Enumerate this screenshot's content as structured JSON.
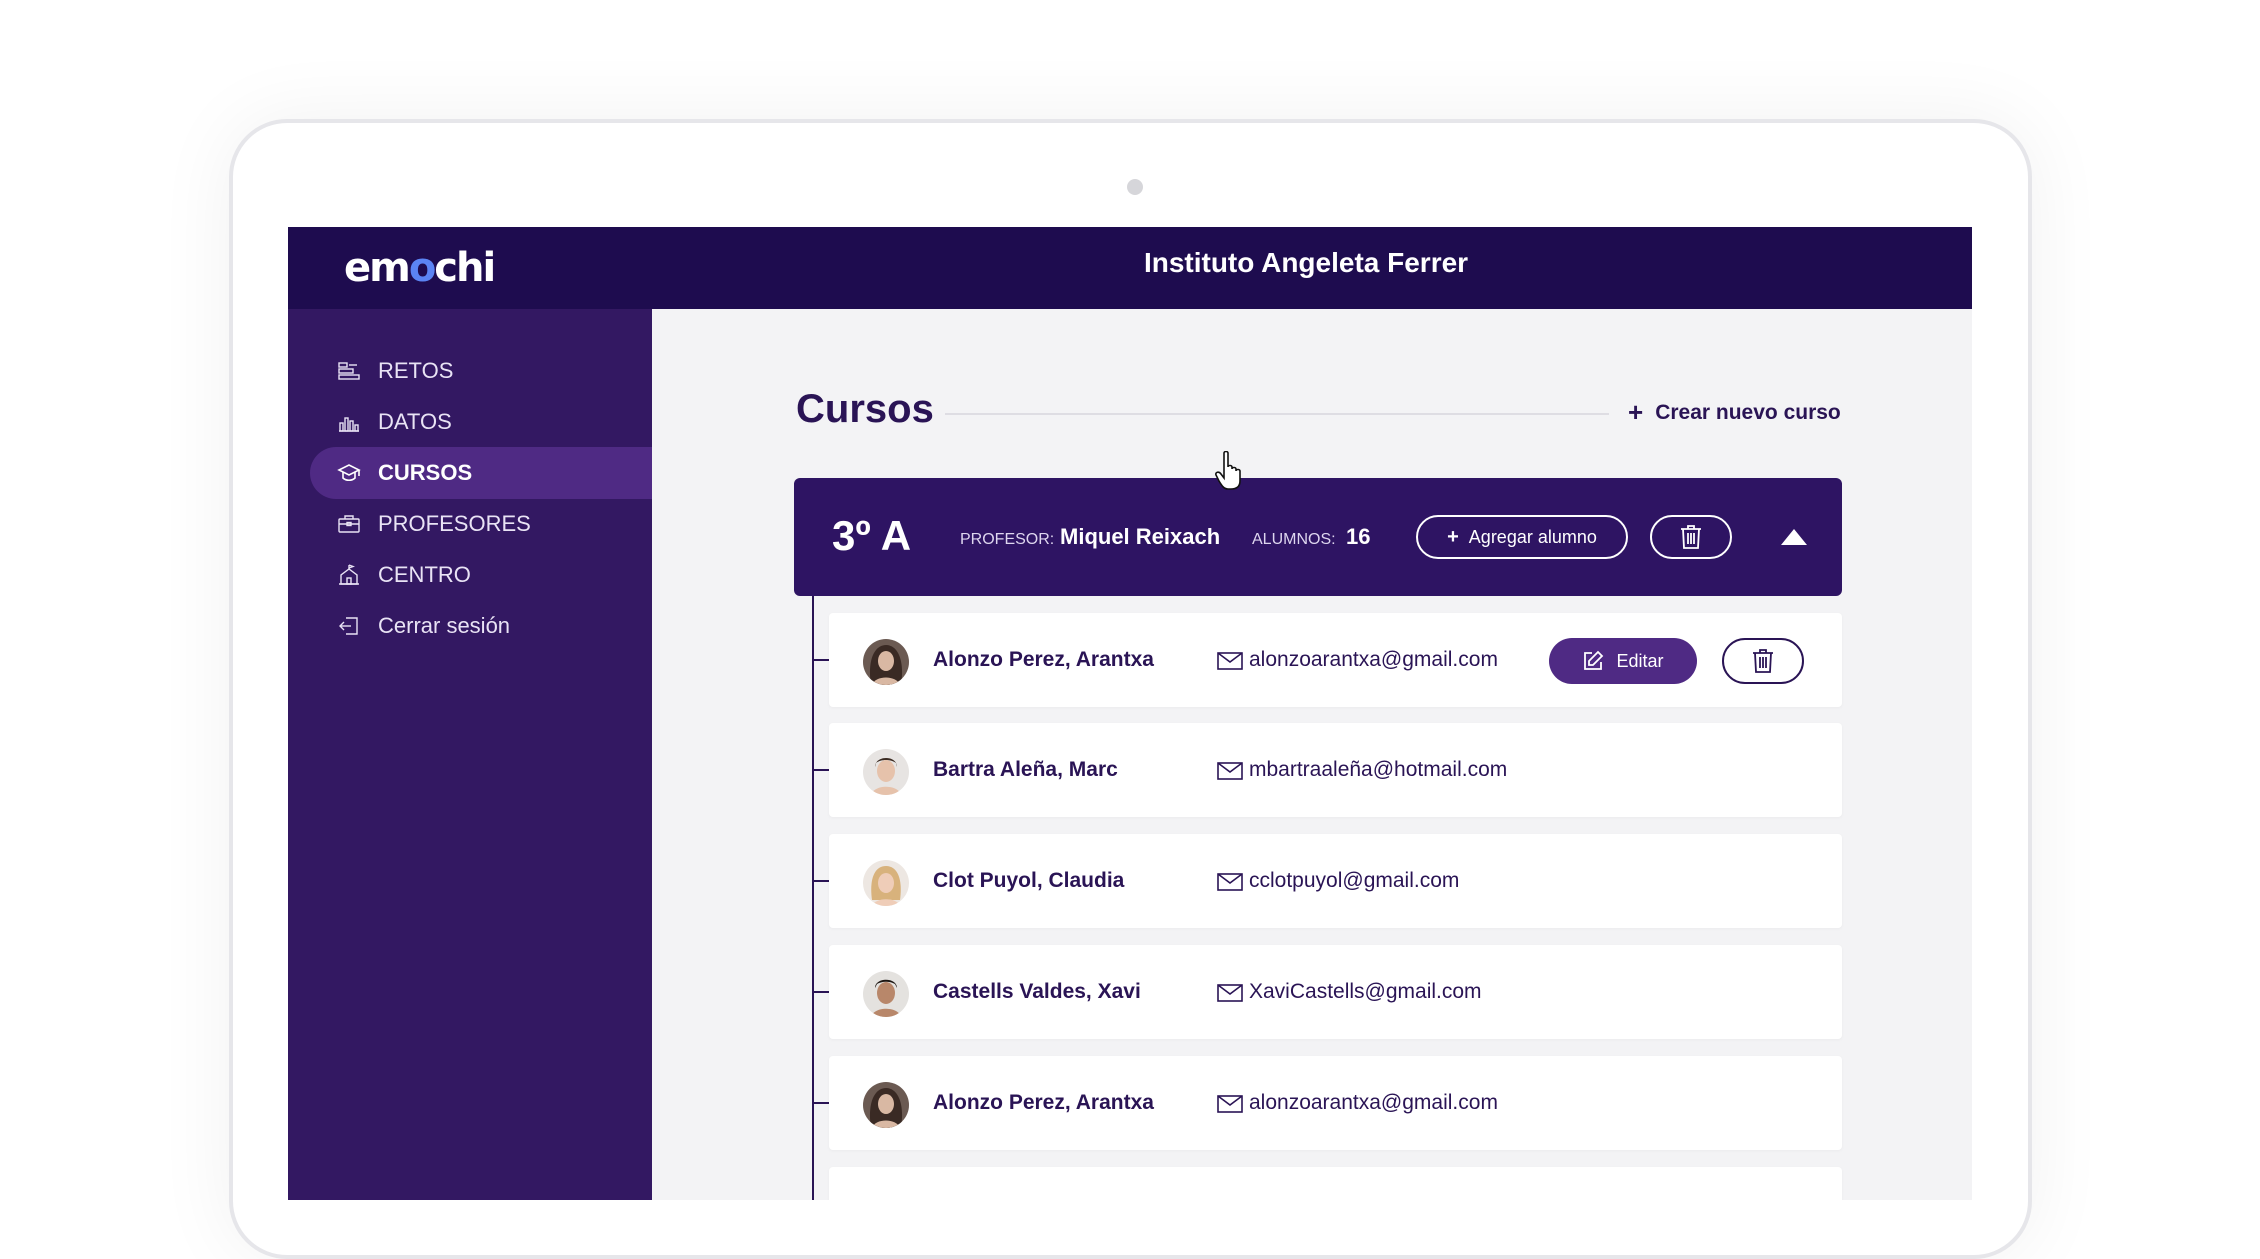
{
  "header": {
    "logo": {
      "text_before": "em",
      "text_dot": "o",
      "text_after": "chi"
    },
    "institution": "Instituto Angeleta Ferrer"
  },
  "sidebar": {
    "items": [
      {
        "label": "RETOS",
        "icon": "challenges-icon",
        "active": false
      },
      {
        "label": "DATOS",
        "icon": "bar-chart-icon",
        "active": false
      },
      {
        "label": "CURSOS",
        "icon": "graduation-cap-icon",
        "active": true
      },
      {
        "label": "PROFESORES",
        "icon": "briefcase-icon",
        "active": false
      },
      {
        "label": "CENTRO",
        "icon": "building-icon",
        "active": false
      },
      {
        "label": "Cerrar sesión",
        "icon": "logout-icon",
        "active": false
      }
    ]
  },
  "main": {
    "title": "Cursos",
    "create_course": {
      "icon": "+",
      "label": "Crear nuevo curso"
    }
  },
  "course": {
    "name": "3º A",
    "teacher_label": "PROFESOR:",
    "teacher_name": "Miquel Reixach",
    "students_label": "ALUMNOS:",
    "students_count": "16",
    "add_student": {
      "icon": "+",
      "label": "Agregar alumno"
    }
  },
  "students": [
    {
      "name": "Alonzo Perez, Arantxa",
      "email": "alonzoarantxa@gmail.com",
      "edit_label": "Editar"
    },
    {
      "name": "Bartra Aleña, Marc",
      "email": "mbartraaleña@hotmail.com"
    },
    {
      "name": "Clot Puyol, Claudia",
      "email": "cclotpuyol@gmail.com"
    },
    {
      "name": "Castells Valdes, Xavi",
      "email": "XaviCastells@gmail.com"
    },
    {
      "name": "Alonzo Perez, Arantxa",
      "email": "alonzoarantxa@gmail.com"
    }
  ],
  "colors": {
    "topbar": "#1e0c4f",
    "sidebar": "#331862",
    "accent": "#4f2a84",
    "course_header": "#2e1463",
    "text_dark": "#2a1455",
    "logo_dot": "#5b84f4"
  }
}
